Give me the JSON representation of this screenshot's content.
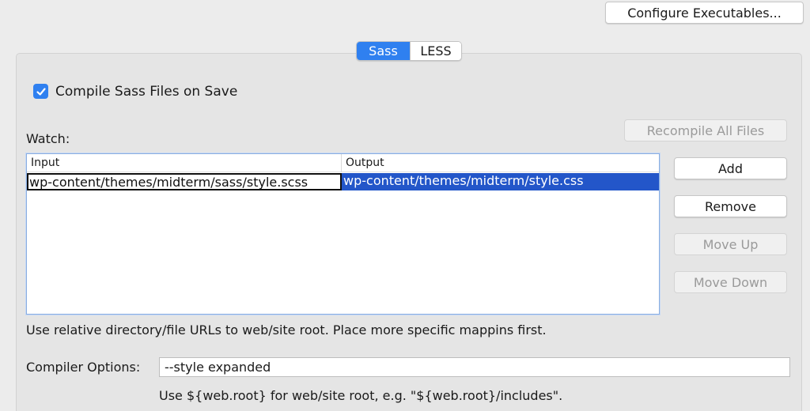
{
  "top": {
    "configure_label": "Configure Executables..."
  },
  "tabs": [
    {
      "label": "Sass",
      "selected": true
    },
    {
      "label": "LESS",
      "selected": false
    }
  ],
  "compile_checkbox": {
    "label": "Compile Sass Files on Save",
    "checked": true
  },
  "watch": {
    "label": "Watch:",
    "columns": [
      "Input",
      "Output"
    ],
    "rows": [
      {
        "input": "wp-content/themes/midterm/sass/style.scss",
        "output": "wp-content/themes/midterm/style.css"
      }
    ]
  },
  "buttons": {
    "recompile": "Recompile All Files",
    "add": "Add",
    "remove": "Remove",
    "move_up": "Move Up",
    "move_down": "Move Down"
  },
  "hint_relative": "Use relative directory/file URLs to web/site root. Place more specific mappins first.",
  "compiler_options": {
    "label": "Compiler Options:",
    "value": "--style expanded"
  },
  "hint_webroot": "Use ${web.root} for web/site root, e.g. \"${web.root}/includes\".",
  "colors": {
    "accent": "#2f80f0",
    "selection": "#2356c9"
  }
}
